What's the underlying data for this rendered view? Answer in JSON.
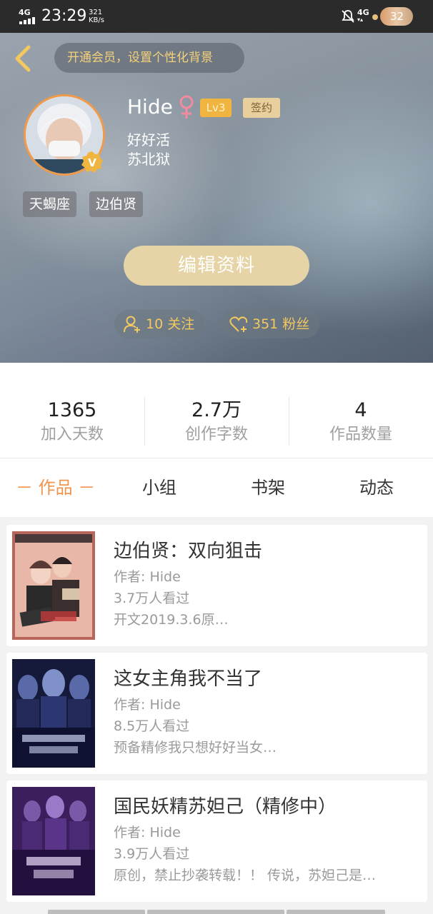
{
  "status_bar": {
    "network": "4G",
    "time": "23:29",
    "speed_value": "321",
    "speed_unit": "KB/s",
    "network_right": "4G",
    "battery": "32"
  },
  "header": {
    "vip_banner": "开通会员，设置个性化背景",
    "username": "Hide",
    "level": "Lv3",
    "signed_badge": "签约",
    "bio_line1": "好好活",
    "bio_line2": "苏北狱",
    "tags": [
      "天蝎座",
      "边伯贤"
    ],
    "edit_button": "编辑资料",
    "following_label": "10 关注",
    "fans_label": "351 粉丝",
    "accent_color": "#f3c85f"
  },
  "stats": [
    {
      "value": "1365",
      "label": "加入天数"
    },
    {
      "value": "2.7万",
      "label": "创作字数"
    },
    {
      "value": "4",
      "label": "作品数量"
    }
  ],
  "tabs": [
    {
      "label": "－ 作品 －",
      "active": true
    },
    {
      "label": "小组",
      "active": false
    },
    {
      "label": "书架",
      "active": false
    },
    {
      "label": "动态",
      "active": false
    }
  ],
  "works": [
    {
      "title": "边伯贤：双向狙击",
      "author": "作者: Hide",
      "views": "3.7万人看过",
      "desc": "开文2019.3.6原…"
    },
    {
      "title": "这女主角我不当了",
      "author": "作者: Hide",
      "views": "8.5万人看过",
      "desc": "预备精修我只想好好当女…"
    },
    {
      "title": "国民妖精苏妲己（精修中）",
      "author": "作者: Hide",
      "views": "3.9万人看过",
      "desc": "原创，禁止抄袭转载！！ 传说，苏妲己是…"
    }
  ]
}
